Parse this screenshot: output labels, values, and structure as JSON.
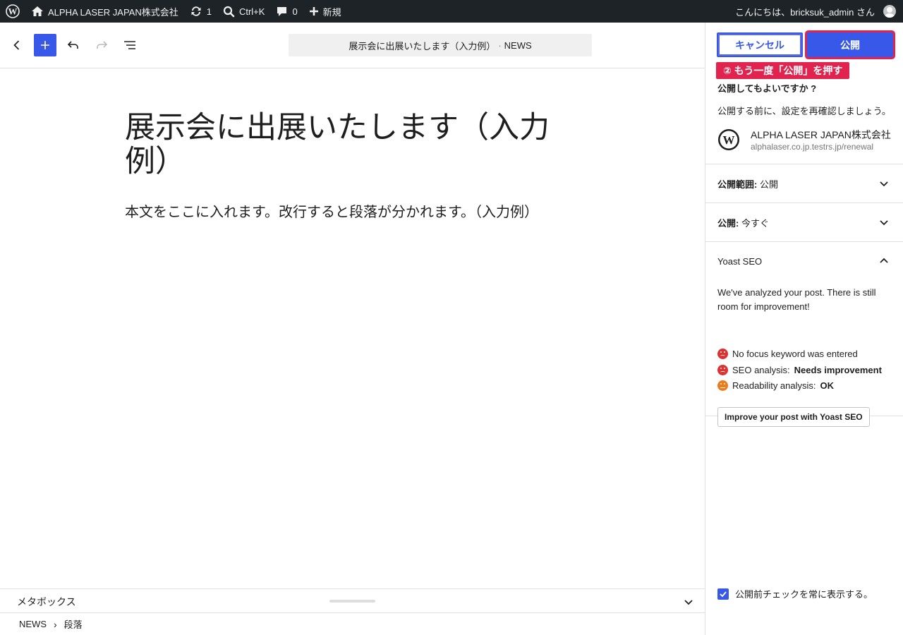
{
  "adminbar": {
    "site_name": "ALPHA LASER JAPAN株式会社",
    "updates_count": "1",
    "search_shortcut": "Ctrl+K",
    "comments_count": "0",
    "new_label": "新規",
    "greeting": "こんにちは、bricksuk_admin さん"
  },
  "header": {
    "document_title": "展示会に出展いたします（入力例）",
    "separator": "·",
    "post_type": "NEWS"
  },
  "canvas": {
    "title": "展示会に出展いたします（入力例）",
    "body": "本文をここに入れます。改行すると段落が分かれます。（入力例）"
  },
  "metabox": {
    "label": "メタボックス"
  },
  "breadcrumbs": {
    "root": "NEWS",
    "separator": "›",
    "current": "段落"
  },
  "sidebar": {
    "cancel_label": "キャンセル",
    "publish_label": "公開",
    "annotation": "② もう一度「公開」を押す",
    "confirm_title": "公開してもよいですか ?",
    "confirm_desc": "公開する前に、設定を再確認しましょう。",
    "site_name": "ALPHA LASER JAPAN株式会社",
    "site_url": "alphalaser.co.jp.testrs.jp/renewal",
    "visibility_label": "公開範囲:",
    "visibility_value": "公開",
    "schedule_label": "公開:",
    "schedule_value": "今すぐ",
    "yoast_title": "Yoast SEO",
    "yoast_intro": "We've analyzed your post. There is still room for improvement!",
    "yoast_items": [
      {
        "text": "No focus keyword was entered",
        "status": "bad"
      },
      {
        "text": "SEO analysis:",
        "value": "Needs improvement",
        "status": "bad"
      },
      {
        "text": "Readability analysis:",
        "value": "OK",
        "status": "ok"
      }
    ],
    "yoast_button": "Improve your post with Yoast SEO",
    "always_show_label": "公開前チェックを常に表示する。",
    "always_show_checked": true
  },
  "colors": {
    "accent": "#3858e9",
    "annotation": "#e0244f",
    "adminbar": "#1d2327",
    "bad": "#dc3232",
    "ok": "#ee7c1b"
  }
}
